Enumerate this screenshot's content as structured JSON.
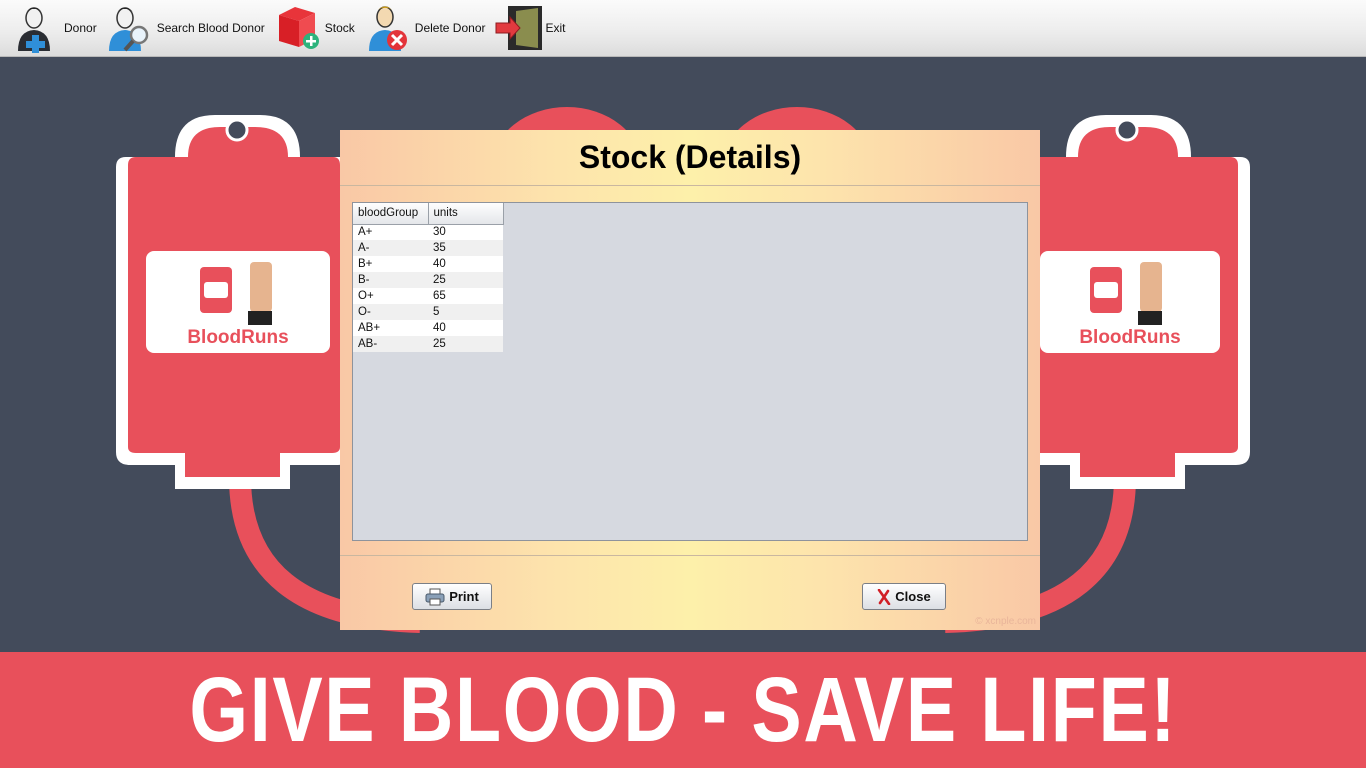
{
  "toolbar": {
    "items": [
      {
        "label": "Donor",
        "icon": "add-user-icon"
      },
      {
        "label": "Search Blood Donor",
        "icon": "search-user-icon"
      },
      {
        "label": "Stock",
        "icon": "stock-box-icon"
      },
      {
        "label": "Delete Donor",
        "icon": "delete-user-icon"
      },
      {
        "label": "Exit",
        "icon": "exit-door-icon"
      }
    ]
  },
  "background": {
    "bag_brand": "BloodRuns",
    "banner": "GIVE BLOOD - SAVE LIFE!"
  },
  "dialog": {
    "title": "Stock (Details)",
    "columns": [
      "bloodGroup",
      "units"
    ],
    "rows": [
      [
        "A+",
        "30"
      ],
      [
        "A-",
        "35"
      ],
      [
        "B+",
        "40"
      ],
      [
        "B-",
        "25"
      ],
      [
        "O+",
        "65"
      ],
      [
        "O-",
        "5"
      ],
      [
        "AB+",
        "40"
      ],
      [
        "AB-",
        "25"
      ]
    ],
    "print_label": "Print",
    "close_label": "Close",
    "watermark": "© xcnple.com"
  },
  "colors": {
    "background": "#434b5b",
    "blood_red": "#e8505b",
    "dialog_gradient_center": "#fdf0aa",
    "dialog_gradient_edge": "#f9c8a6"
  }
}
